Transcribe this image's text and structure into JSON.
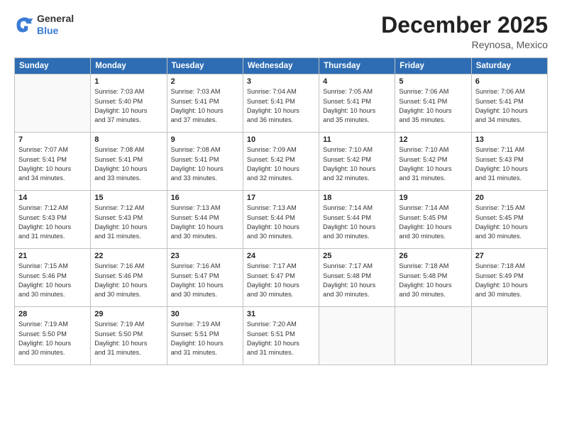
{
  "header": {
    "logo_general": "General",
    "logo_blue": "Blue",
    "title": "December 2025",
    "subtitle": "Reynosa, Mexico"
  },
  "weekdays": [
    "Sunday",
    "Monday",
    "Tuesday",
    "Wednesday",
    "Thursday",
    "Friday",
    "Saturday"
  ],
  "weeks": [
    [
      {
        "day": "",
        "info": ""
      },
      {
        "day": "1",
        "info": "Sunrise: 7:03 AM\nSunset: 5:40 PM\nDaylight: 10 hours\nand 37 minutes."
      },
      {
        "day": "2",
        "info": "Sunrise: 7:03 AM\nSunset: 5:41 PM\nDaylight: 10 hours\nand 37 minutes."
      },
      {
        "day": "3",
        "info": "Sunrise: 7:04 AM\nSunset: 5:41 PM\nDaylight: 10 hours\nand 36 minutes."
      },
      {
        "day": "4",
        "info": "Sunrise: 7:05 AM\nSunset: 5:41 PM\nDaylight: 10 hours\nand 35 minutes."
      },
      {
        "day": "5",
        "info": "Sunrise: 7:06 AM\nSunset: 5:41 PM\nDaylight: 10 hours\nand 35 minutes."
      },
      {
        "day": "6",
        "info": "Sunrise: 7:06 AM\nSunset: 5:41 PM\nDaylight: 10 hours\nand 34 minutes."
      }
    ],
    [
      {
        "day": "7",
        "info": "Sunrise: 7:07 AM\nSunset: 5:41 PM\nDaylight: 10 hours\nand 34 minutes."
      },
      {
        "day": "8",
        "info": "Sunrise: 7:08 AM\nSunset: 5:41 PM\nDaylight: 10 hours\nand 33 minutes."
      },
      {
        "day": "9",
        "info": "Sunrise: 7:08 AM\nSunset: 5:41 PM\nDaylight: 10 hours\nand 33 minutes."
      },
      {
        "day": "10",
        "info": "Sunrise: 7:09 AM\nSunset: 5:42 PM\nDaylight: 10 hours\nand 32 minutes."
      },
      {
        "day": "11",
        "info": "Sunrise: 7:10 AM\nSunset: 5:42 PM\nDaylight: 10 hours\nand 32 minutes."
      },
      {
        "day": "12",
        "info": "Sunrise: 7:10 AM\nSunset: 5:42 PM\nDaylight: 10 hours\nand 31 minutes."
      },
      {
        "day": "13",
        "info": "Sunrise: 7:11 AM\nSunset: 5:43 PM\nDaylight: 10 hours\nand 31 minutes."
      }
    ],
    [
      {
        "day": "14",
        "info": "Sunrise: 7:12 AM\nSunset: 5:43 PM\nDaylight: 10 hours\nand 31 minutes."
      },
      {
        "day": "15",
        "info": "Sunrise: 7:12 AM\nSunset: 5:43 PM\nDaylight: 10 hours\nand 31 minutes."
      },
      {
        "day": "16",
        "info": "Sunrise: 7:13 AM\nSunset: 5:44 PM\nDaylight: 10 hours\nand 30 minutes."
      },
      {
        "day": "17",
        "info": "Sunrise: 7:13 AM\nSunset: 5:44 PM\nDaylight: 10 hours\nand 30 minutes."
      },
      {
        "day": "18",
        "info": "Sunrise: 7:14 AM\nSunset: 5:44 PM\nDaylight: 10 hours\nand 30 minutes."
      },
      {
        "day": "19",
        "info": "Sunrise: 7:14 AM\nSunset: 5:45 PM\nDaylight: 10 hours\nand 30 minutes."
      },
      {
        "day": "20",
        "info": "Sunrise: 7:15 AM\nSunset: 5:45 PM\nDaylight: 10 hours\nand 30 minutes."
      }
    ],
    [
      {
        "day": "21",
        "info": "Sunrise: 7:15 AM\nSunset: 5:46 PM\nDaylight: 10 hours\nand 30 minutes."
      },
      {
        "day": "22",
        "info": "Sunrise: 7:16 AM\nSunset: 5:46 PM\nDaylight: 10 hours\nand 30 minutes."
      },
      {
        "day": "23",
        "info": "Sunrise: 7:16 AM\nSunset: 5:47 PM\nDaylight: 10 hours\nand 30 minutes."
      },
      {
        "day": "24",
        "info": "Sunrise: 7:17 AM\nSunset: 5:47 PM\nDaylight: 10 hours\nand 30 minutes."
      },
      {
        "day": "25",
        "info": "Sunrise: 7:17 AM\nSunset: 5:48 PM\nDaylight: 10 hours\nand 30 minutes."
      },
      {
        "day": "26",
        "info": "Sunrise: 7:18 AM\nSunset: 5:48 PM\nDaylight: 10 hours\nand 30 minutes."
      },
      {
        "day": "27",
        "info": "Sunrise: 7:18 AM\nSunset: 5:49 PM\nDaylight: 10 hours\nand 30 minutes."
      }
    ],
    [
      {
        "day": "28",
        "info": "Sunrise: 7:19 AM\nSunset: 5:50 PM\nDaylight: 10 hours\nand 30 minutes."
      },
      {
        "day": "29",
        "info": "Sunrise: 7:19 AM\nSunset: 5:50 PM\nDaylight: 10 hours\nand 31 minutes."
      },
      {
        "day": "30",
        "info": "Sunrise: 7:19 AM\nSunset: 5:51 PM\nDaylight: 10 hours\nand 31 minutes."
      },
      {
        "day": "31",
        "info": "Sunrise: 7:20 AM\nSunset: 5:51 PM\nDaylight: 10 hours\nand 31 minutes."
      },
      {
        "day": "",
        "info": ""
      },
      {
        "day": "",
        "info": ""
      },
      {
        "day": "",
        "info": ""
      }
    ]
  ]
}
